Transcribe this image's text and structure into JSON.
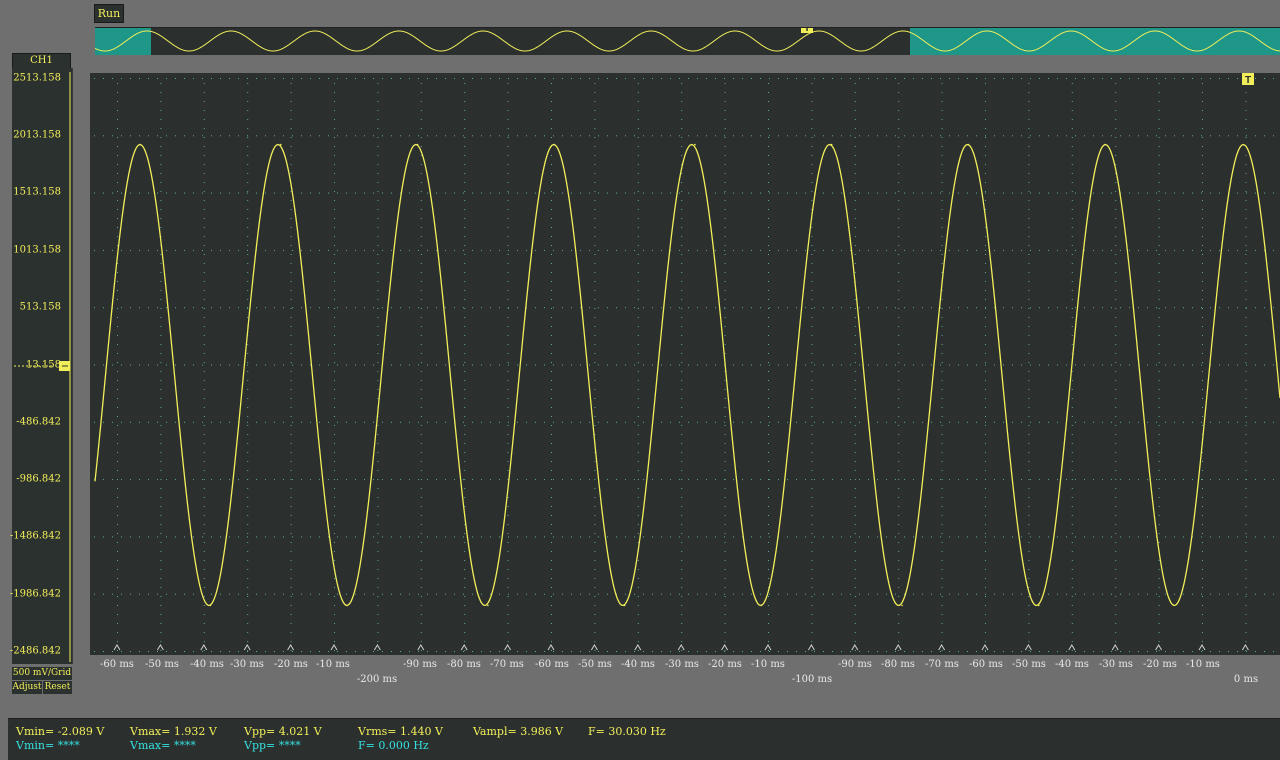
{
  "toolbar": {
    "run_label": "Run"
  },
  "channel": {
    "label": "CH1",
    "color": "#f2ee5a"
  },
  "y_axis": {
    "labels": [
      "2513.158",
      "2013.158",
      "1513.158",
      "1013.158",
      "513.158",
      "13.158",
      "-486.842",
      "-986.842",
      "-1486.842",
      "-1986.842",
      "-2486.842"
    ]
  },
  "x_axis": {
    "tick_labels": [
      "-60 ms",
      "-50 ms",
      "-40 ms",
      "-30 ms",
      "-20 ms",
      "-10 ms",
      "-90 ms",
      "-80 ms",
      "-70 ms",
      "-60 ms",
      "-50 ms",
      "-40 ms",
      "-30 ms",
      "-20 ms",
      "-10 ms",
      "-90 ms",
      "-80 ms",
      "-70 ms",
      "-60 ms",
      "-50 ms",
      "-40 ms",
      "-30 ms",
      "-20 ms",
      "-10 ms"
    ],
    "major_labels": [
      "-200 ms",
      "-100 ms",
      "0 ms"
    ]
  },
  "controls": {
    "scale_label": "500 mV/Grid",
    "adjust_label": "Adjust",
    "reset_label": "Reset"
  },
  "markers": {
    "trigger_label": "T"
  },
  "measurements": {
    "vmin": "Vmin= -2.089 V",
    "vmax": "Vmax= 1.932 V",
    "vpp": "Vpp= 4.021 V",
    "vrms": "Vrms= 1.440 V",
    "vampl": "Vampl= 3.986 V",
    "freq": "F= 30.030 Hz",
    "vmin2": "Vmin= ****",
    "vmax2": "Vmax= ****",
    "vpp2": "Vpp= ****",
    "freq2": "F= 0.000 Hz"
  },
  "colors": {
    "trace": "#f2ee5a",
    "grid_dots": "#5fa8a0",
    "overview_highlight": "#1e9688",
    "secondary_text": "#34e0e0"
  },
  "chart_data": {
    "type": "line",
    "title": "",
    "xlabel": "",
    "ylabel": "",
    "x_unit": "ms",
    "y_unit": "mV",
    "ylim": [
      -2486.842,
      2513.158
    ],
    "frequency_hz": 30.03,
    "peak_mv": 1932,
    "trough_mv": -2089,
    "peak_times_ms": [
      -240,
      -206,
      -173,
      -140,
      -106,
      -73,
      -40,
      -7
    ],
    "trough_times_ms": [
      -223,
      -190,
      -156,
      -123,
      -90,
      -56,
      -23
    ]
  }
}
